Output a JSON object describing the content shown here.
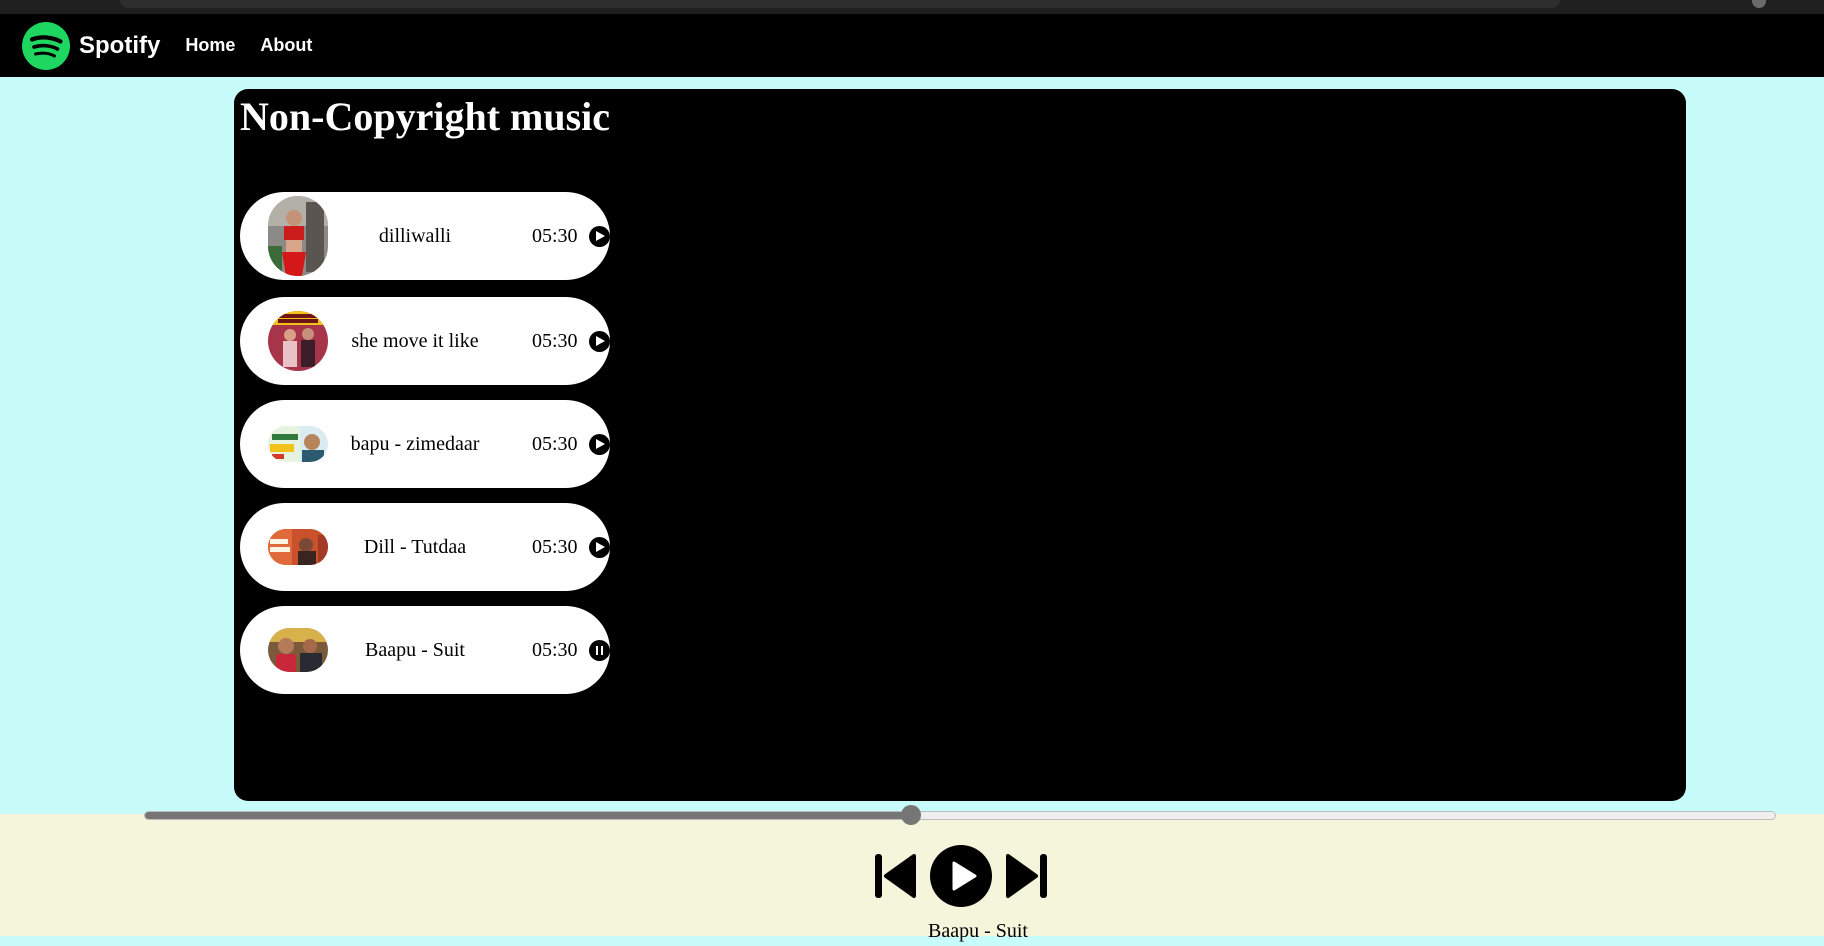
{
  "navbar": {
    "brand": "Spotify",
    "links": [
      "Home",
      "About"
    ],
    "logo_icon": "spotify-logo-icon",
    "logo_color": "#1ed760"
  },
  "page": {
    "title": "Non-Copyright music",
    "background": "#c7fcfb"
  },
  "songs": [
    {
      "name": "dilliwalli",
      "duration": "05:30",
      "state": "play",
      "cover_icon": "album-cover-image"
    },
    {
      "name": "she move it like",
      "duration": "05:30",
      "state": "play",
      "cover_icon": "album-cover-image"
    },
    {
      "name": "bapu - zimedaar",
      "duration": "05:30",
      "state": "play",
      "cover_icon": "album-cover-image"
    },
    {
      "name": "Dill - Tutdaa",
      "duration": "05:30",
      "state": "play",
      "cover_icon": "album-cover-image"
    },
    {
      "name": "Baapu - Suit",
      "duration": "05:30",
      "state": "pause",
      "cover_icon": "album-cover-image"
    }
  ],
  "player": {
    "progress_fraction": 0.47,
    "now_playing": "Baapu - Suit",
    "controls": [
      "previous-icon",
      "play-icon",
      "next-icon"
    ],
    "background": "#f5f5dc"
  }
}
